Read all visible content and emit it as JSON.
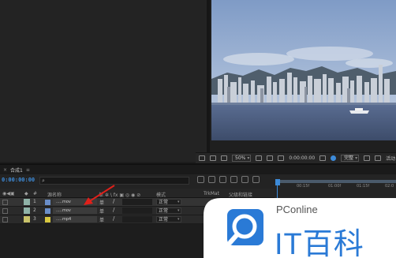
{
  "timeline": {
    "tab_title": "合成1",
    "tab_close": "≡",
    "timecode": "0:00:00:00",
    "search_placeholder": "",
    "headers": {
      "hash": "#",
      "source_name": "源名称",
      "switches": "单 ✲ \\ fx ▣ ◎ ◉ ⊘",
      "mode": "模式",
      "trkmat": "TrkMat",
      "parent": "父级和链接"
    },
    "ruler_ticks": [
      "00:15f",
      "01:00f",
      "01:15f",
      "02:0"
    ],
    "layers": [
      {
        "num": "1",
        "name": ".....mov",
        "sw": "单",
        "slash": "/",
        "mode": "正常",
        "label_color": "#8fb3a8",
        "thumb_color": "#6a8ec9",
        "selected": true
      },
      {
        "num": "2",
        "name": ".....mov",
        "sw": "单",
        "slash": "/",
        "mode": "正常",
        "label_color": "#8fb3a8",
        "thumb_color": "#6a8ec9",
        "selected": false
      },
      {
        "num": "3",
        "name": ".....mp4",
        "sw": "单",
        "slash": "/",
        "mode": "正常",
        "label_color": "#c8c26a",
        "thumb_color": "#d8c840",
        "selected": false
      }
    ]
  },
  "viewer": {
    "zoom": "50%",
    "timecode": "0:00:00:00",
    "quality": "完整",
    "extra": "活动"
  },
  "watermark": {
    "brand": "PConline",
    "big_text": "IT百科"
  },
  "colors": {
    "accent": "#3d8bd9",
    "arrow": "#e0201a"
  }
}
